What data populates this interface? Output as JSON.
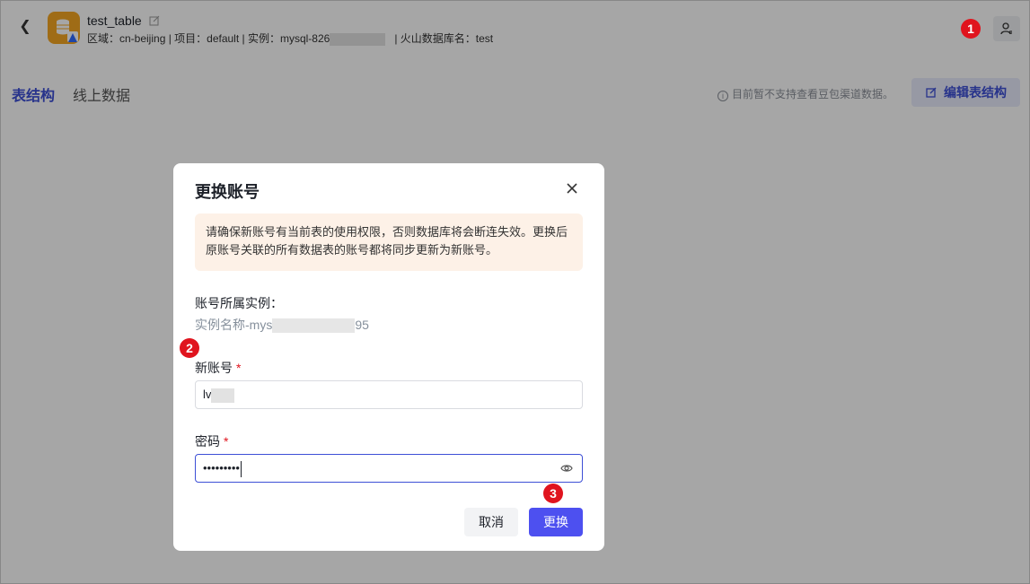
{
  "header": {
    "title": "test_table",
    "meta_prefix": "区域：cn-beijing | 项目：default | 实例：mysql-826",
    "meta_suffix": "|  火山数据库名：test"
  },
  "tabs": [
    {
      "label": "表结构",
      "active": true
    },
    {
      "label": "线上数据",
      "active": false
    }
  ],
  "notice": "目前暂不支持查看豆包渠道数据。",
  "edit_schema_label": "编辑表结构",
  "badges": [
    "1",
    "2",
    "3"
  ],
  "modal": {
    "title": "更换账号",
    "alert": "请确保新账号有当前表的使用权限，否则数据库将会断连失效。更换后原账号关联的所有数据表的账号都将同步更新为新账号。",
    "instance_label": "账号所属实例：",
    "instance_prefix": "实例名称-mys",
    "instance_suffix": "95",
    "account_label": "新账号",
    "account_value": "lv",
    "password_label": "密码",
    "password_value": "•••••••••",
    "required_mark": "*",
    "cancel_label": "取消",
    "confirm_label": "更换"
  },
  "colors": {
    "accent": "#4d50f0",
    "tab_active": "#3d4fd6",
    "badge": "#e0141e",
    "alert_bg": "#fdf1e7",
    "db_icon": "#f5a623"
  },
  "icons": [
    "back-icon",
    "database-icon",
    "edit-icon",
    "user-switch-icon",
    "info-icon",
    "edit-schema-icon",
    "close-icon",
    "eye-icon"
  ]
}
